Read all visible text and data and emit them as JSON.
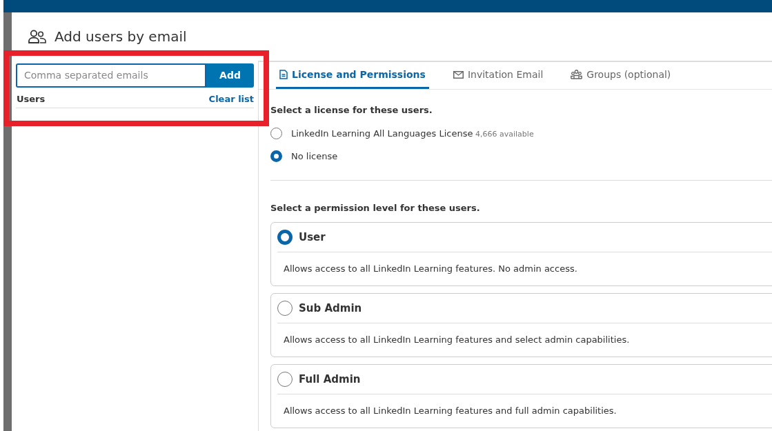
{
  "title": "Add users by email",
  "email_field": {
    "placeholder": "Comma separated emails"
  },
  "add_button": "Add",
  "users_list": {
    "heading": "Users",
    "clear_link": "Clear list"
  },
  "tabs": [
    {
      "label": "License and Permissions",
      "selected": true
    },
    {
      "label": "Invitation Email",
      "selected": false
    },
    {
      "label": "Groups (optional)",
      "selected": false
    }
  ],
  "license_prompt": "Select a license for these users.",
  "licenses": [
    {
      "name": "LinkedIn Learning All Languages License",
      "note": "4,666 available",
      "selected": false
    },
    {
      "name": "No license",
      "selected": true
    }
  ],
  "permission_prompt": "Select a permission level for these users.",
  "permissions": [
    {
      "name": "User",
      "description": "Allows access to all LinkedIn Learning features. No admin access.",
      "selected": true
    },
    {
      "name": "Sub Admin",
      "description": "Allows access to all LinkedIn Learning features and select admin capabilities.",
      "selected": false
    },
    {
      "name": "Full Admin",
      "description": "Allows access to all LinkedIn Learning features and full admin capabilities.",
      "selected": false
    }
  ],
  "annotation": {
    "kind": "highlight-frame"
  }
}
